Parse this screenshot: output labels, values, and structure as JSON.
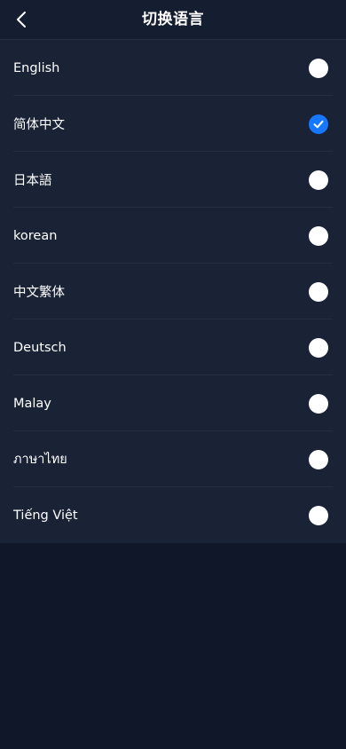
{
  "header": {
    "title": "切换语言",
    "back_icon": "chevron-left-icon"
  },
  "languages": [
    {
      "label": "English",
      "selected": false
    },
    {
      "label": "简体中文",
      "selected": true
    },
    {
      "label": "日本語",
      "selected": false
    },
    {
      "label": "korean",
      "selected": false
    },
    {
      "label": "中文繁体",
      "selected": false
    },
    {
      "label": "Deutsch",
      "selected": false
    },
    {
      "label": "Malay",
      "selected": false
    },
    {
      "label": "ภาษาไทย",
      "selected": false
    },
    {
      "label": "Tiếng Việt",
      "selected": false
    }
  ],
  "colors": {
    "page_bg": "#101728",
    "header_bg": "#151d30",
    "list_bg": "#1a2236",
    "accent": "#1677ff",
    "radio_unselected": "#ffffff"
  }
}
